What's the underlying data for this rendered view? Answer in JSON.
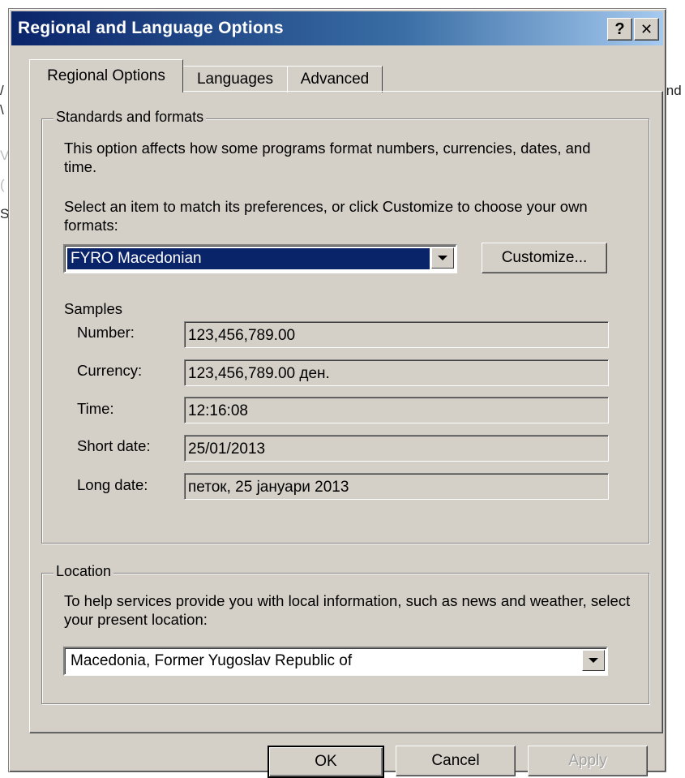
{
  "background": {
    "fragments": [
      "/",
      "\\",
      "V",
      "(",
      "S",
      "ind"
    ]
  },
  "dialog": {
    "title": "Regional and Language Options",
    "help_label": "?",
    "close_label": "✕"
  },
  "tabs": [
    {
      "label": "Regional Options",
      "active": true
    },
    {
      "label": "Languages",
      "active": false
    },
    {
      "label": "Advanced",
      "active": false
    }
  ],
  "standards": {
    "legend": "Standards and formats",
    "description": "This option affects how some programs format numbers, currencies, dates, and time.",
    "instruction": "Select an item to match its preferences, or click Customize to choose your own formats:",
    "selected_format": "FYRO Macedonian",
    "customize_label": "Customize...",
    "samples_heading": "Samples",
    "samples": [
      {
        "label": "Number:",
        "value": "123,456,789.00"
      },
      {
        "label": "Currency:",
        "value": "123,456,789.00 ден."
      },
      {
        "label": "Time:",
        "value": "12:16:08"
      },
      {
        "label": "Short date:",
        "value": "25/01/2013"
      },
      {
        "label": "Long date:",
        "value": "петок, 25 јануари 2013"
      }
    ]
  },
  "location": {
    "legend": "Location",
    "description": "To help services provide you with local information, such as news and weather, select your present location:",
    "selected_location": "Macedonia, Former Yugoslav Republic of"
  },
  "footer": {
    "ok_label": "OK",
    "cancel_label": "Cancel",
    "apply_label": "Apply"
  }
}
